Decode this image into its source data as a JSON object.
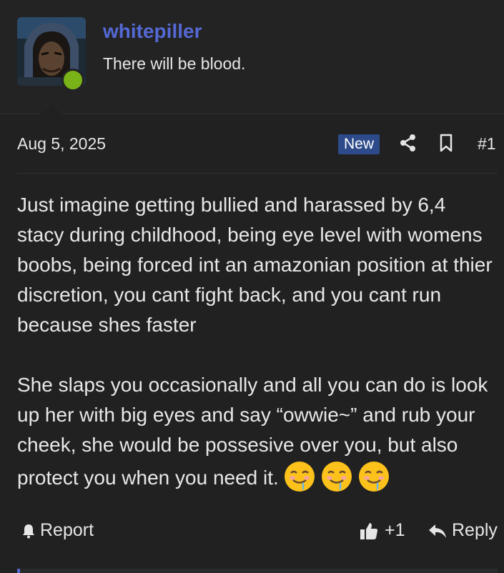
{
  "user": {
    "name": "whitepiller",
    "title": "There will be blood.",
    "online": true
  },
  "post": {
    "date": "Aug 5, 2025",
    "badge": "New",
    "number": "#1",
    "paragraphs": [
      "Just imagine getting bullied and harassed by 6,4 stacy during childhood, being eye level with womens boobs, being forced int an amazonian position at thier discretion, you cant fight back, and you cant run because shes faster",
      "She slaps you occasionally and all you can do is look up her with big eyes and say “owwie~” and rub your cheek, she would be possesive over you, but also protect you when you need it."
    ],
    "emojis": [
      "drooling-face-icon",
      "drooling-face-icon",
      "drooling-face-icon"
    ]
  },
  "actions": {
    "report": "Report",
    "like_count": "+1",
    "reply": "Reply"
  },
  "colors": {
    "username": "#5469d4",
    "online": "#7ab317",
    "badge_bg": "#2d4a8a"
  }
}
